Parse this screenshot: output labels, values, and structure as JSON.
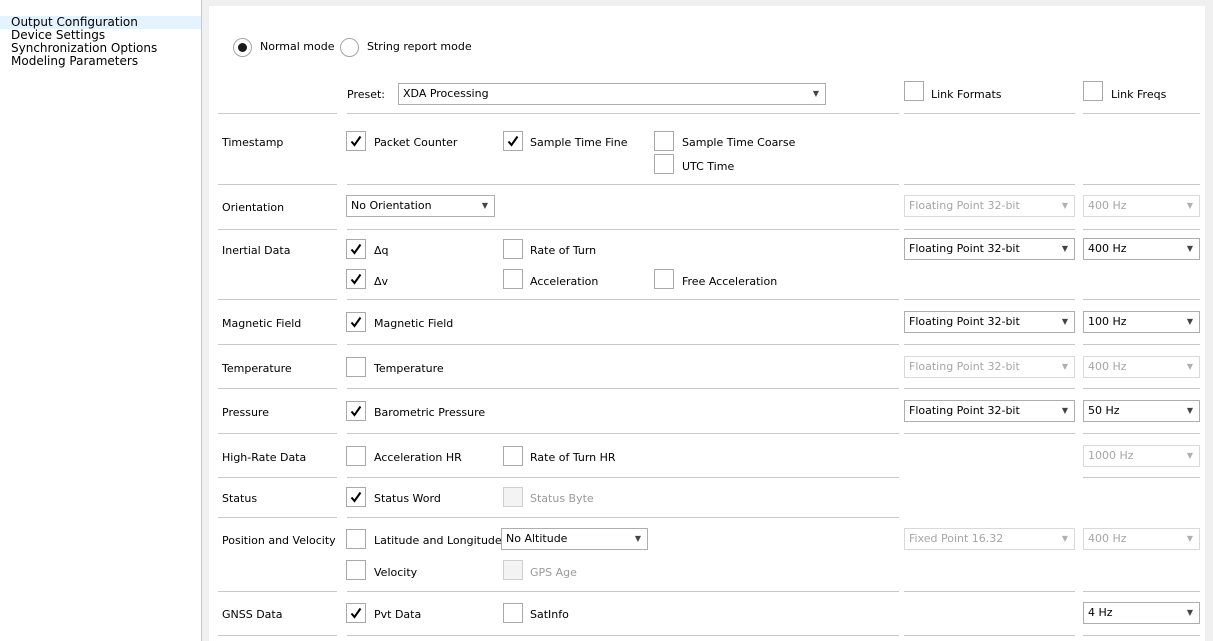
{
  "sidebar": {
    "items": [
      {
        "label": "Output Configuration",
        "selected": true
      },
      {
        "label": "Device Settings"
      },
      {
        "label": "Synchronization Options"
      },
      {
        "label": "Modeling Parameters"
      }
    ]
  },
  "mode": {
    "normal_label": "Normal mode",
    "string_label": "String report mode",
    "selected": "normal"
  },
  "preset": {
    "label": "Preset:",
    "value": "XDA Processing"
  },
  "link_formats_label": "Link Formats",
  "link_freqs_label": "Link Freqs",
  "rows": {
    "timestamp": {
      "label": "Timestamp",
      "packet_counter": "Packet Counter",
      "sample_time_fine": "Sample Time Fine",
      "sample_time_coarse": "Sample Time Coarse",
      "utc_time": "UTC Time"
    },
    "orientation": {
      "label": "Orientation",
      "select": "No Orientation",
      "format": "Floating Point 32-bit",
      "freq": "400 Hz"
    },
    "inertial": {
      "label": "Inertial Data",
      "dq": "Δq",
      "rate_of_turn": "Rate of Turn",
      "dv": "Δv",
      "acceleration": "Acceleration",
      "free_acceleration": "Free Acceleration",
      "format": "Floating Point 32-bit",
      "freq": "400 Hz"
    },
    "magnetic": {
      "label": "Magnetic Field",
      "magnetic_field": "Magnetic Field",
      "format": "Floating Point 32-bit",
      "freq": "100 Hz"
    },
    "temperature": {
      "label": "Temperature",
      "temperature": "Temperature",
      "format": "Floating Point 32-bit",
      "freq": "400 Hz"
    },
    "pressure": {
      "label": "Pressure",
      "barometric": "Barometric Pressure",
      "format": "Floating Point 32-bit",
      "freq": "50 Hz"
    },
    "highrate": {
      "label": "High-Rate Data",
      "acceleration_hr": "Acceleration HR",
      "rate_of_turn_hr": "Rate of Turn HR",
      "freq": "1000 Hz"
    },
    "status": {
      "label": "Status",
      "status_word": "Status Word",
      "status_byte": "Status Byte"
    },
    "position": {
      "label": "Position and Velocity",
      "lat_lon": "Latitude and Longitude",
      "altitude": "No Altitude",
      "velocity": "Velocity",
      "gps_age": "GPS Age",
      "format": "Fixed Point 16.32",
      "freq": "400 Hz"
    },
    "gnss": {
      "label": "GNSS Data",
      "pvt": "Pvt Data",
      "satinfo": "SatInfo",
      "freq": "4 Hz"
    }
  }
}
